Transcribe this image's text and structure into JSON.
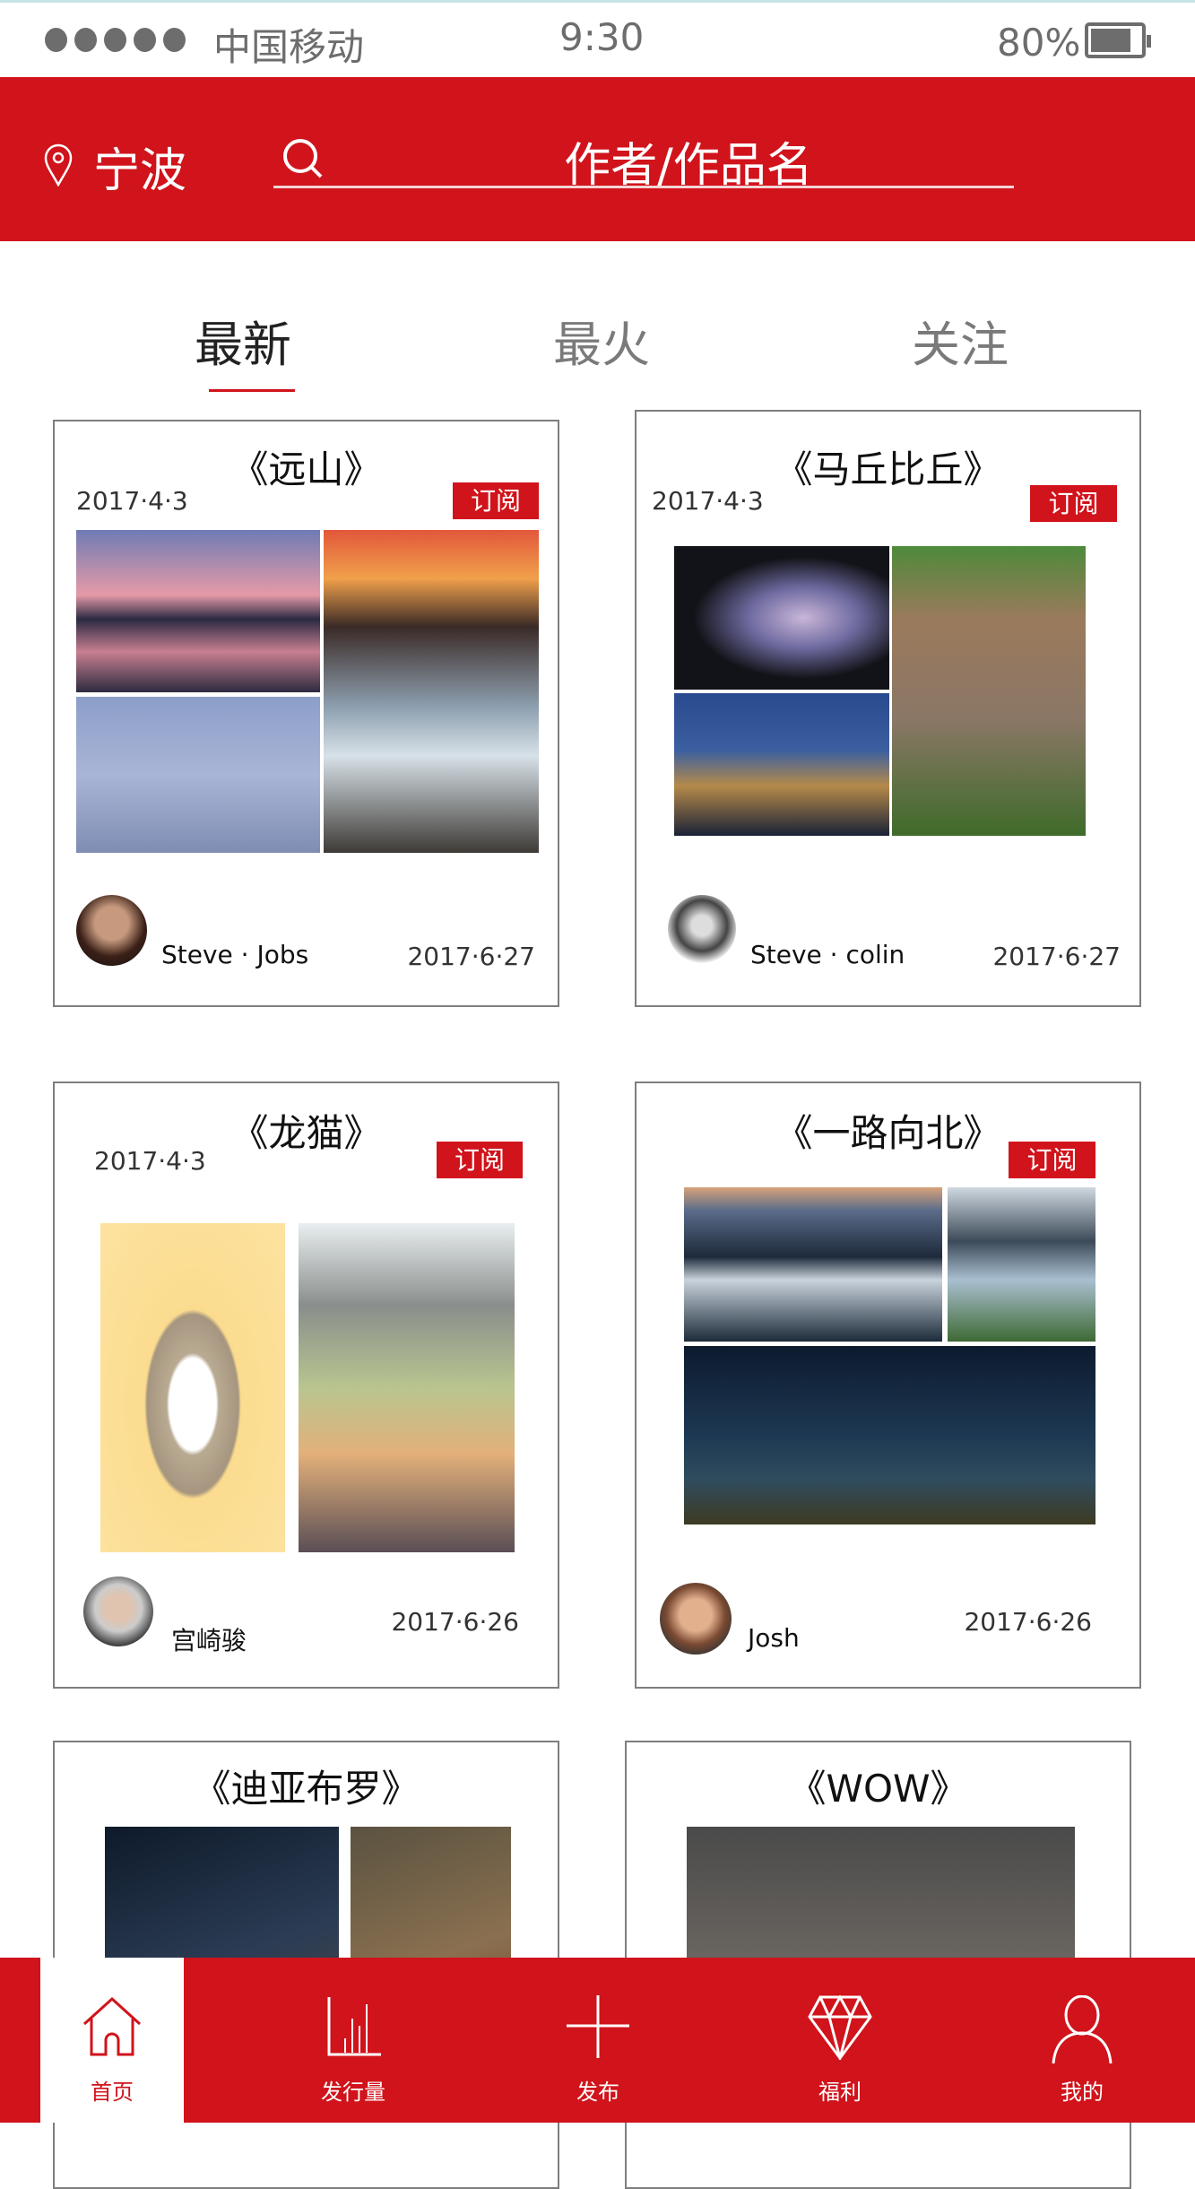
{
  "status_bar": {
    "carrier": "中国移动",
    "time": "9:30",
    "battery": "80%",
    "battery_level": 0.8,
    "signal_bars": 5
  },
  "header": {
    "city": "宁波",
    "search_placeholder": "作者/作品名",
    "icons": [
      "location-pin-icon",
      "search-icon"
    ]
  },
  "tabs": [
    {
      "label": "最新",
      "active": true
    },
    {
      "label": "最火",
      "active": false
    },
    {
      "label": "关注",
      "active": false
    }
  ],
  "cards": [
    {
      "title": "《远山》",
      "date": "2017·4·3",
      "subscribe": "订阅",
      "author": "Steve · Jobs",
      "updated": "2017·6·27"
    },
    {
      "title": "《马丘比丘》",
      "date": "2017·4·3",
      "subscribe": "订阅",
      "author": "Steve · colin",
      "updated": "2017·6·27"
    },
    {
      "title": "《龙猫》",
      "date": "2017·4·3",
      "subscribe": "订阅",
      "author": "宫崎骏",
      "updated": "2017·6·26"
    },
    {
      "title": "《一路向北》",
      "subscribe": "订阅",
      "author": "Josh",
      "updated": "2017·6·26"
    },
    {
      "title": "《迪亚布罗》"
    },
    {
      "title": "《WOW》"
    }
  ],
  "nav": [
    {
      "label": "首页",
      "icon": "home-icon",
      "active": true
    },
    {
      "label": "发行量",
      "icon": "bar-chart-icon"
    },
    {
      "label": "发布",
      "icon": "plus-icon"
    },
    {
      "label": "福利",
      "icon": "diamond-icon"
    },
    {
      "label": "我的",
      "icon": "user-icon"
    }
  ],
  "colors": {
    "accent": "#d1131b",
    "status_text": "#6d6d6d",
    "card_border": "#7e7e7e"
  }
}
